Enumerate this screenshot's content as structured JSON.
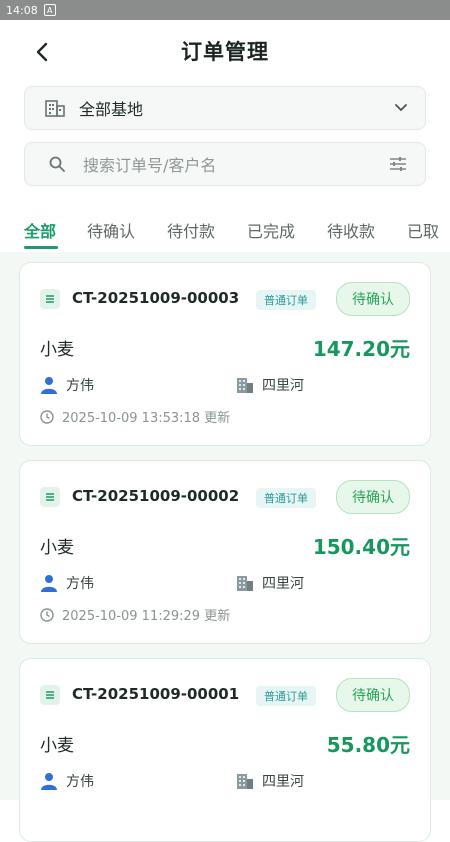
{
  "status_bar": {
    "time": "14:08",
    "sim_icon": "A"
  },
  "header": {
    "title": "订单管理"
  },
  "base_select": {
    "value": "全部基地"
  },
  "search": {
    "placeholder": "搜索订单号/客户名"
  },
  "tabs": [
    {
      "label": "全部",
      "active": true
    },
    {
      "label": "待确认"
    },
    {
      "label": "待付款"
    },
    {
      "label": "已完成"
    },
    {
      "label": "待收款"
    },
    {
      "label": "已取"
    }
  ],
  "orders": [
    {
      "order_no": "CT-20251009-00003",
      "type": "普通订单",
      "status": "待确认",
      "product": "小麦",
      "amount": "147.20元",
      "customer": "方伟",
      "base": "四里河",
      "updated": "2025-10-09 13:53:18 更新"
    },
    {
      "order_no": "CT-20251009-00002",
      "type": "普通订单",
      "status": "待确认",
      "product": "小麦",
      "amount": "150.40元",
      "customer": "方伟",
      "base": "四里河",
      "updated": "2025-10-09 11:29:29 更新"
    },
    {
      "order_no": "CT-20251009-00001",
      "type": "普通订单",
      "status": "待确认",
      "product": "小麦",
      "amount": "55.80元",
      "customer": "方伟",
      "base": "四里河",
      "updated": ""
    }
  ],
  "colors": {
    "accent": "#1d9b6a",
    "amount": "#16975d",
    "status_bg": "#e7f7ea"
  },
  "icons": [
    "back-arrow-icon",
    "building-icon",
    "chevron-down-icon",
    "search-icon",
    "filter-icon",
    "document-icon",
    "person-icon",
    "building-icon",
    "clock-icon"
  ]
}
